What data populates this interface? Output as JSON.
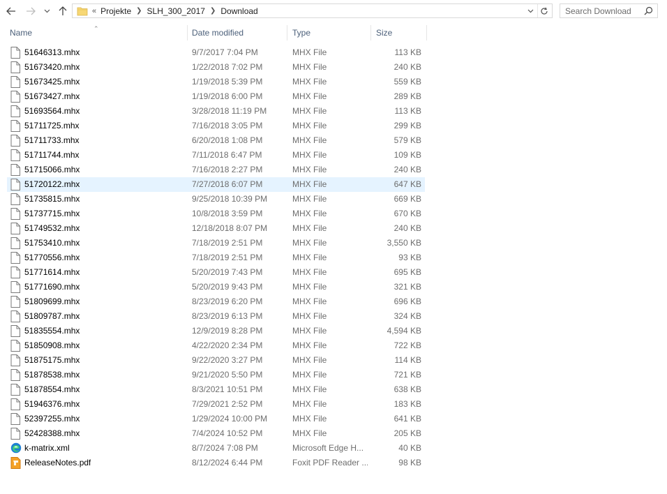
{
  "nav": {
    "back": "back-arrow",
    "forward": "forward-arrow",
    "recent": "chevron-down",
    "up": "up-arrow"
  },
  "address": {
    "overflow": "«",
    "crumbs": [
      "Projekte",
      "SLH_300_2017",
      "Download"
    ]
  },
  "search": {
    "placeholder": "Search Download"
  },
  "columns": {
    "name": "Name",
    "date": "Date modified",
    "type": "Type",
    "size": "Size"
  },
  "files": [
    {
      "name": "51646313.mhx",
      "date": "9/7/2017 7:04 PM",
      "type": "MHX File",
      "size": "113 KB",
      "icon": "file"
    },
    {
      "name": "51673420.mhx",
      "date": "1/22/2018 7:02 PM",
      "type": "MHX File",
      "size": "240 KB",
      "icon": "file"
    },
    {
      "name": "51673425.mhx",
      "date": "1/19/2018 5:39 PM",
      "type": "MHX File",
      "size": "559 KB",
      "icon": "file"
    },
    {
      "name": "51673427.mhx",
      "date": "1/19/2018 6:00 PM",
      "type": "MHX File",
      "size": "289 KB",
      "icon": "file"
    },
    {
      "name": "51693564.mhx",
      "date": "3/28/2018 11:19 PM",
      "type": "MHX File",
      "size": "113 KB",
      "icon": "file"
    },
    {
      "name": "51711725.mhx",
      "date": "7/16/2018 3:05 PM",
      "type": "MHX File",
      "size": "299 KB",
      "icon": "file"
    },
    {
      "name": "51711733.mhx",
      "date": "6/20/2018 1:08 PM",
      "type": "MHX File",
      "size": "579 KB",
      "icon": "file"
    },
    {
      "name": "51711744.mhx",
      "date": "7/11/2018 6:47 PM",
      "type": "MHX File",
      "size": "109 KB",
      "icon": "file"
    },
    {
      "name": "51715066.mhx",
      "date": "7/16/2018 2:27 PM",
      "type": "MHX File",
      "size": "240 KB",
      "icon": "file"
    },
    {
      "name": "51720122.mhx",
      "date": "7/27/2018 6:07 PM",
      "type": "MHX File",
      "size": "647 KB",
      "icon": "file",
      "selected": true
    },
    {
      "name": "51735815.mhx",
      "date": "9/25/2018 10:39 PM",
      "type": "MHX File",
      "size": "669 KB",
      "icon": "file"
    },
    {
      "name": "51737715.mhx",
      "date": "10/8/2018 3:59 PM",
      "type": "MHX File",
      "size": "670 KB",
      "icon": "file"
    },
    {
      "name": "51749532.mhx",
      "date": "12/18/2018 8:07 PM",
      "type": "MHX File",
      "size": "240 KB",
      "icon": "file"
    },
    {
      "name": "51753410.mhx",
      "date": "7/18/2019 2:51 PM",
      "type": "MHX File",
      "size": "3,550 KB",
      "icon": "file"
    },
    {
      "name": "51770556.mhx",
      "date": "7/18/2019 2:51 PM",
      "type": "MHX File",
      "size": "93 KB",
      "icon": "file"
    },
    {
      "name": "51771614.mhx",
      "date": "5/20/2019 7:43 PM",
      "type": "MHX File",
      "size": "695 KB",
      "icon": "file"
    },
    {
      "name": "51771690.mhx",
      "date": "5/20/2019 9:43 PM",
      "type": "MHX File",
      "size": "321 KB",
      "icon": "file"
    },
    {
      "name": "51809699.mhx",
      "date": "8/23/2019 6:20 PM",
      "type": "MHX File",
      "size": "696 KB",
      "icon": "file"
    },
    {
      "name": "51809787.mhx",
      "date": "8/23/2019 6:13 PM",
      "type": "MHX File",
      "size": "324 KB",
      "icon": "file"
    },
    {
      "name": "51835554.mhx",
      "date": "12/9/2019 8:28 PM",
      "type": "MHX File",
      "size": "4,594 KB",
      "icon": "file"
    },
    {
      "name": "51850908.mhx",
      "date": "4/22/2020 2:34 PM",
      "type": "MHX File",
      "size": "722 KB",
      "icon": "file"
    },
    {
      "name": "51875175.mhx",
      "date": "9/22/2020 3:27 PM",
      "type": "MHX File",
      "size": "114 KB",
      "icon": "file"
    },
    {
      "name": "51878538.mhx",
      "date": "9/21/2020 5:50 PM",
      "type": "MHX File",
      "size": "721 KB",
      "icon": "file"
    },
    {
      "name": "51878554.mhx",
      "date": "8/3/2021 10:51 PM",
      "type": "MHX File",
      "size": "638 KB",
      "icon": "file"
    },
    {
      "name": "51946376.mhx",
      "date": "7/29/2021 2:52 PM",
      "type": "MHX File",
      "size": "183 KB",
      "icon": "file"
    },
    {
      "name": "52397255.mhx",
      "date": "1/29/2024 10:00 PM",
      "type": "MHX File",
      "size": "641 KB",
      "icon": "file"
    },
    {
      "name": "52428388.mhx",
      "date": "7/4/2024 10:52 PM",
      "type": "MHX File",
      "size": "205 KB",
      "icon": "file"
    },
    {
      "name": "k-matrix.xml",
      "date": "8/7/2024 7:08 PM",
      "type": "Microsoft Edge H...",
      "size": "40 KB",
      "icon": "edge"
    },
    {
      "name": "ReleaseNotes.pdf",
      "date": "8/12/2024 6:44 PM",
      "type": "Foxit PDF Reader ...",
      "size": "98 KB",
      "icon": "pdf"
    }
  ],
  "colors": {
    "header_text": "#4c607a",
    "selected_row": "#e5f3ff",
    "meta_text": "#6d6d6d"
  }
}
